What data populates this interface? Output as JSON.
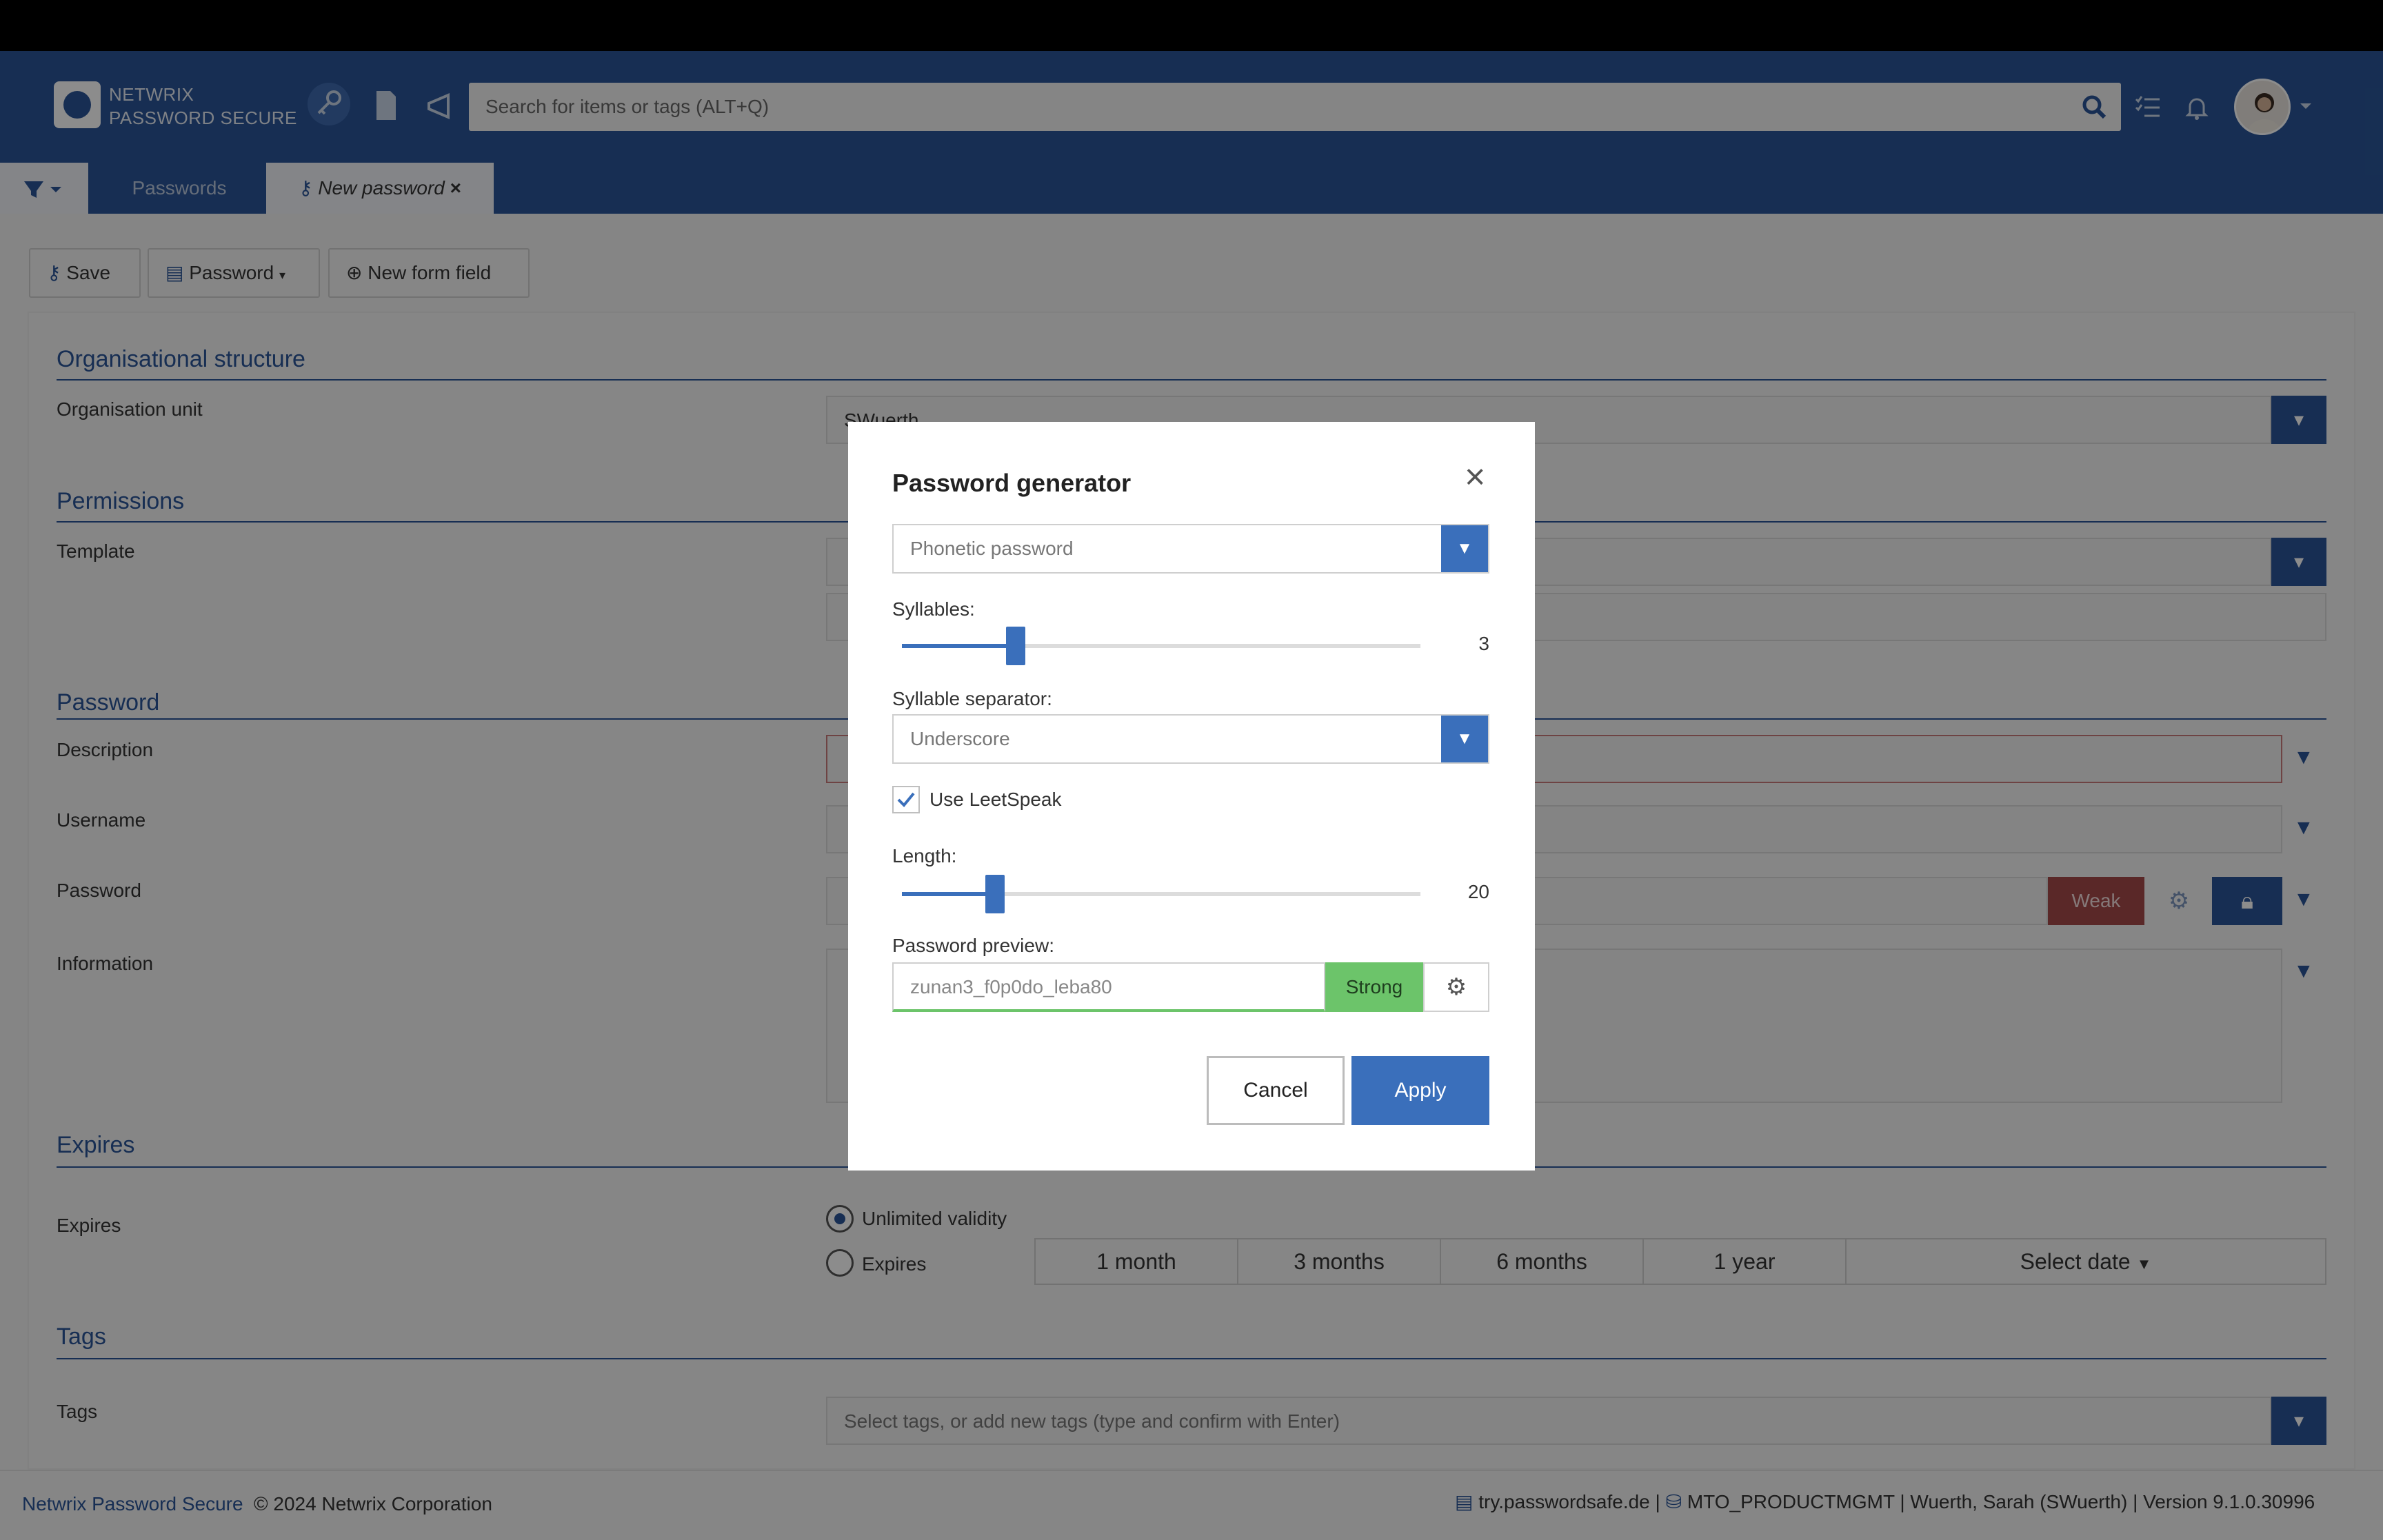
{
  "app": {
    "logo_line1": "NETWRIX",
    "logo_line2": "PASSWORD SECURE",
    "search_placeholder": "Search for items or tags (ALT+Q)",
    "icons": [
      "key-icon",
      "document-icon",
      "bullhorn-icon",
      "search-icon",
      "checklist-icon",
      "bell-icon",
      "avatar",
      "caret-down-icon"
    ]
  },
  "tabs": {
    "passwords": "Passwords",
    "new_password": "New password",
    "close": "×"
  },
  "toolbar": {
    "save": "Save",
    "password": "Password",
    "new_form_field": "New form field"
  },
  "form": {
    "org_section": "Organisational structure",
    "org_unit_label": "Organisation unit",
    "org_unit_value": "SWuerth",
    "permissions_section": "Permissions",
    "template_label": "Template",
    "password_section": "Password",
    "description_label": "Description",
    "username_label": "Username",
    "password_label": "Password",
    "strength_weak": "Weak",
    "information_label": "Information",
    "expires_section": "Expires",
    "expires_label": "Expires",
    "unlimited_validity": "Unlimited validity",
    "expires_option": "Expires",
    "periods": [
      "1 month",
      "3 months",
      "6 months",
      "1 year"
    ],
    "select_date": "Select date",
    "tags_section": "Tags",
    "tags_label": "Tags",
    "tags_placeholder": "Select tags, or add new tags (type and confirm with Enter)"
  },
  "dialog": {
    "title": "Password generator",
    "close": "×",
    "type_value": "Phonetic password",
    "syllables_label": "Syllables:",
    "syllables_value": "3",
    "syllables_fraction": 0.22,
    "separator_label": "Syllable separator:",
    "separator_value": "Underscore",
    "leetspeak_label": "Use LeetSpeak",
    "leetspeak_checked": true,
    "length_label": "Length:",
    "length_value": "20",
    "length_fraction": 0.18,
    "preview_label": "Password preview:",
    "preview_value": "zunan3_f0p0do_leba80",
    "strength": "Strong",
    "cancel": "Cancel",
    "apply": "Apply"
  },
  "footer": {
    "product_link": "Netwrix Password Secure",
    "copyright": "© 2024 Netwrix Corporation",
    "server": "try.passwordsafe.de",
    "separator": "|",
    "database": "MTO_PRODUCTMGMT",
    "user_version": "| Wuerth, Sarah (SWuerth) | Version 9.1.0.30996"
  },
  "colors": {
    "brand_blue": "#2a5598",
    "accent_blue": "#3a6fbb",
    "weak_red": "#a54a4a",
    "strong_green": "#6cc46a"
  }
}
